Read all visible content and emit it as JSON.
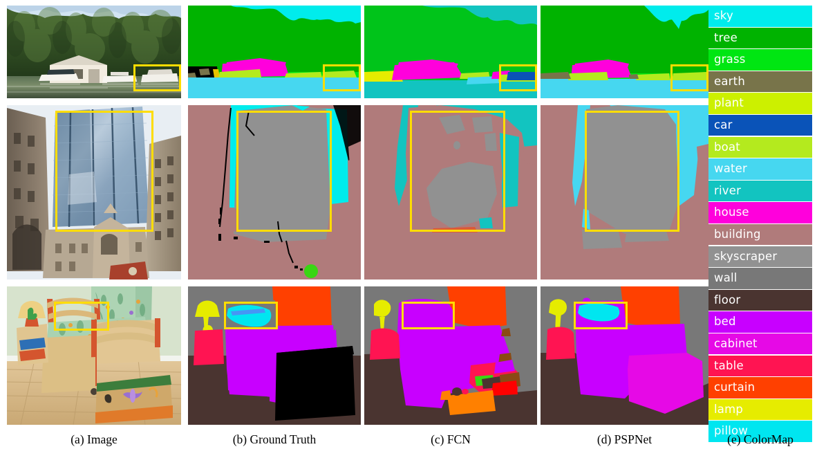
{
  "figure": {
    "columns": [
      {
        "id": "image",
        "caption": "(a) Image"
      },
      {
        "id": "ground_truth",
        "caption": "(b) Ground Truth"
      },
      {
        "id": "fcn",
        "caption": "(c) FCN"
      },
      {
        "id": "pspnet",
        "caption": "(d) PSPNet"
      },
      {
        "id": "colormap",
        "caption": "(e) ColorMap"
      }
    ],
    "highlight_box_color": "#ffdd00",
    "rows": [
      {
        "id": "row-boathouse",
        "scene": "boathouse on lake with trees and boats"
      },
      {
        "id": "row-skyscraper",
        "scene": "glass skyscraper between older buildings"
      },
      {
        "id": "row-bedroom",
        "scene": "child bedroom with bed, lamp, toy chest"
      }
    ]
  },
  "colormap": {
    "title": "ColorMap",
    "entries": [
      {
        "label": "sky",
        "color": "#00ecec"
      },
      {
        "label": "tree",
        "color": "#00b300"
      },
      {
        "label": "grass",
        "color": "#00e612"
      },
      {
        "label": "earth",
        "color": "#78744a"
      },
      {
        "label": "plant",
        "color": "#ccf000"
      },
      {
        "label": "car",
        "color": "#0a53b8"
      },
      {
        "label": "boat",
        "color": "#b4ea1e"
      },
      {
        "label": "water",
        "color": "#46d7f0"
      },
      {
        "label": "river",
        "color": "#12c4c0"
      },
      {
        "label": "house",
        "color": "#ff00dc"
      },
      {
        "label": "building",
        "color": "#b07b7b"
      },
      {
        "label": "skyscraper",
        "color": "#919191"
      },
      {
        "label": "wall",
        "color": "#787878"
      },
      {
        "label": "floor",
        "color": "#4a3430"
      },
      {
        "label": "bed",
        "color": "#c800ff"
      },
      {
        "label": "cabinet",
        "color": "#e609e6"
      },
      {
        "label": "table",
        "color": "#ff1452"
      },
      {
        "label": "curtain",
        "color": "#ff4000"
      },
      {
        "label": "lamp",
        "color": "#e6ec00"
      },
      {
        "label": "pillow",
        "color": "#00e6f0"
      }
    ]
  },
  "palette": {
    "sky": "#00ecec",
    "tree": "#00b300",
    "grass": "#00e612",
    "earth": "#78744a",
    "plant": "#ccf000",
    "car": "#0a53b8",
    "boat": "#b4ea1e",
    "water": "#46d7f0",
    "river": "#12c4c0",
    "house": "#ff00dc",
    "building": "#b07b7b",
    "skyscraper": "#919191",
    "wall": "#787878",
    "floor": "#4a3430",
    "bed": "#c800ff",
    "cabinet": "#e609e6",
    "table": "#ff1452",
    "curtain": "#ff4000",
    "lamp": "#e6ec00",
    "pillow": "#00e6f0",
    "black": "#000000",
    "green_small": "#39d613",
    "orange": "#ff8000",
    "dark_red": "#c0392b",
    "brown": "#8a4a14"
  },
  "captions": {
    "a": "(a) Image",
    "b": "(b) Ground Truth",
    "c": "(c) FCN",
    "d": "(d) PSPNet",
    "e": "(e) ColorMap"
  }
}
